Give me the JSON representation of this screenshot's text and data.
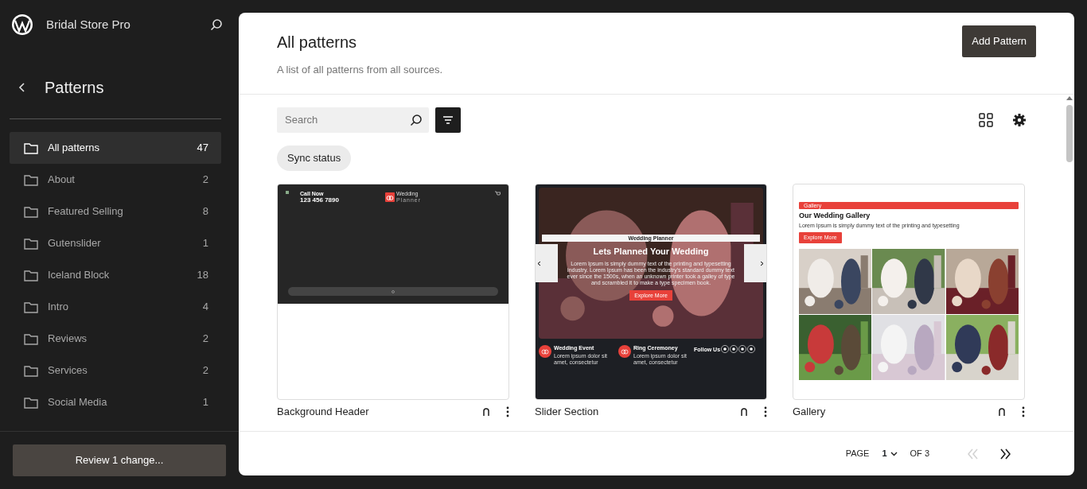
{
  "site": {
    "title": "Bridal Store Pro"
  },
  "sidebar": {
    "heading": "Patterns",
    "items": [
      {
        "label": "All patterns",
        "count": "47",
        "selected": true
      },
      {
        "label": "About",
        "count": "2",
        "selected": false
      },
      {
        "label": "Featured Selling",
        "count": "8",
        "selected": false
      },
      {
        "label": "Gutenslider",
        "count": "1",
        "selected": false
      },
      {
        "label": "Iceland Block",
        "count": "18",
        "selected": false
      },
      {
        "label": "Intro",
        "count": "4",
        "selected": false
      },
      {
        "label": "Reviews",
        "count": "2",
        "selected": false
      },
      {
        "label": "Services",
        "count": "2",
        "selected": false
      },
      {
        "label": "Social Media",
        "count": "1",
        "selected": false
      }
    ],
    "review_button": "Review 1 change..."
  },
  "main": {
    "title": "All patterns",
    "description": "A list of all patterns from all sources.",
    "add_button": "Add Pattern",
    "search": {
      "placeholder": "Search"
    },
    "filter_chip": "Sync status",
    "patterns": [
      {
        "kind": "header",
        "title": "Background Header",
        "call_label": "Call Now",
        "phone": "123 456 7890",
        "logo_name": "Wedding",
        "logo_sub": "Planner"
      },
      {
        "kind": "slider",
        "title": "Slider Section",
        "tag": "Wedding Planner",
        "heading": "Lets Planned Your Wedding",
        "text": "Lorem Ipsum is simply dummy text of the printing and typesetting industry. Lorem Ipsum has been the industry's standard dummy text ever since the 1500s, when an unknown printer took a galley of type and scrambled it to make a type specimen book.",
        "button": "Explore More",
        "features": [
          {
            "title": "Wedding Event",
            "text": "Lorem ipsum dolor sit amet, consectetur"
          },
          {
            "title": "Ring Ceremoney",
            "text": "Lorem ipsum dolor sit amet, consectetur"
          }
        ],
        "follow": "Follow Us"
      },
      {
        "kind": "gallery",
        "title": "Gallery",
        "tag": "Gallery",
        "heading": "Our Wedding Gallery",
        "text": "Lorem Ipsum is simply dummy text of the printing and typesetting",
        "button": "Explore More"
      }
    ],
    "pagination": {
      "page_label": "PAGE",
      "page": "1",
      "of": "OF 3",
      "prev_disabled": true,
      "next_disabled": false
    }
  }
}
